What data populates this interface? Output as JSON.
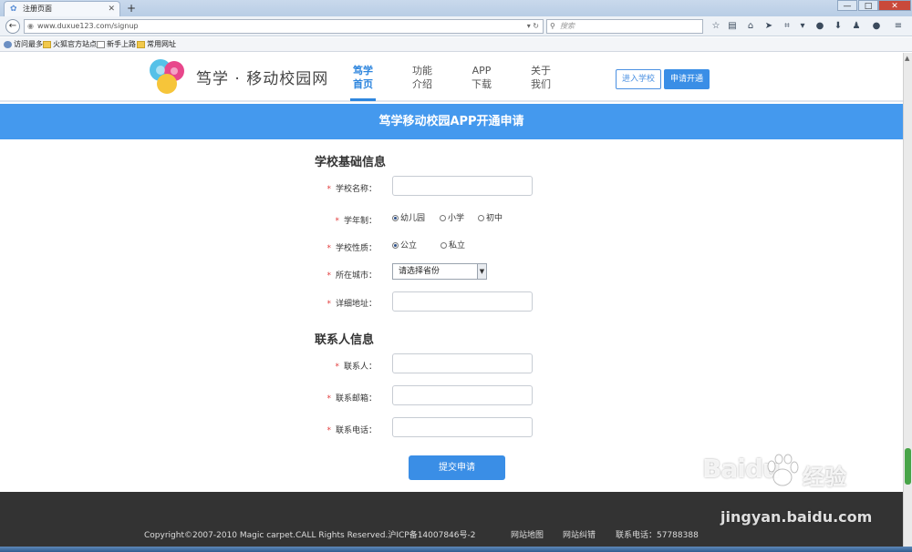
{
  "browser": {
    "tab_title": "注册页面",
    "new_tab": "+",
    "address": "www.duxue123.com/signup",
    "search_placeholder": "搜索",
    "window_controls": {
      "minimize": "—",
      "maximize": "□",
      "close": "✕"
    },
    "bookmarks": [
      "访问最多",
      "火狐官方站点",
      "新手上路",
      "常用网址"
    ]
  },
  "site": {
    "logo_text": "笃学 · 移动校园网",
    "menu": [
      {
        "line1": "笃学",
        "line2": "首页",
        "active": true
      },
      {
        "line1": "功能",
        "line2": "介绍",
        "active": false
      },
      {
        "line1": "APP",
        "line2": "下载",
        "active": false
      },
      {
        "line1": "关于",
        "line2": "我们",
        "active": false
      }
    ],
    "enter_school": "进入学校",
    "apply_open": "申请开通"
  },
  "banner_title": "笃学移动校园APP开通申请",
  "form": {
    "required_mark": "*",
    "school_section": "学校基础信息",
    "school_name_label": "学校名称：",
    "school_system_label": "学年制：",
    "school_system_options": [
      "幼儿园",
      "小学",
      "初中"
    ],
    "school_system_selected": 0,
    "school_type_label": "学校性质：",
    "school_type_options": [
      "公立",
      "私立"
    ],
    "school_type_selected": 0,
    "city_label": "所在城市：",
    "city_select_value": "请选择省份",
    "address_label": "详细地址：",
    "contact_section": "联系人信息",
    "contact_label": "联系人：",
    "email_label": "联系邮箱：",
    "phone_label": "联系电话：",
    "submit_label": "提交申请"
  },
  "footer": {
    "copyright": "Copyright©2007-2010 Magic carpet.CALL Rights Reserved.沪ICP备14007846号-2",
    "sitemap": "网站地图",
    "error_report": "网站纠错",
    "contact_phone": "联系电话：57788388"
  },
  "watermark": {
    "brand": "Bai",
    "brand_suffix": "du",
    "cn": "经验",
    "url": "jingyan.baidu.com"
  },
  "colors": {
    "accent": "#3a8ee6",
    "banner": "#4499ee",
    "footer": "#333333",
    "required": "#e23c3c"
  }
}
